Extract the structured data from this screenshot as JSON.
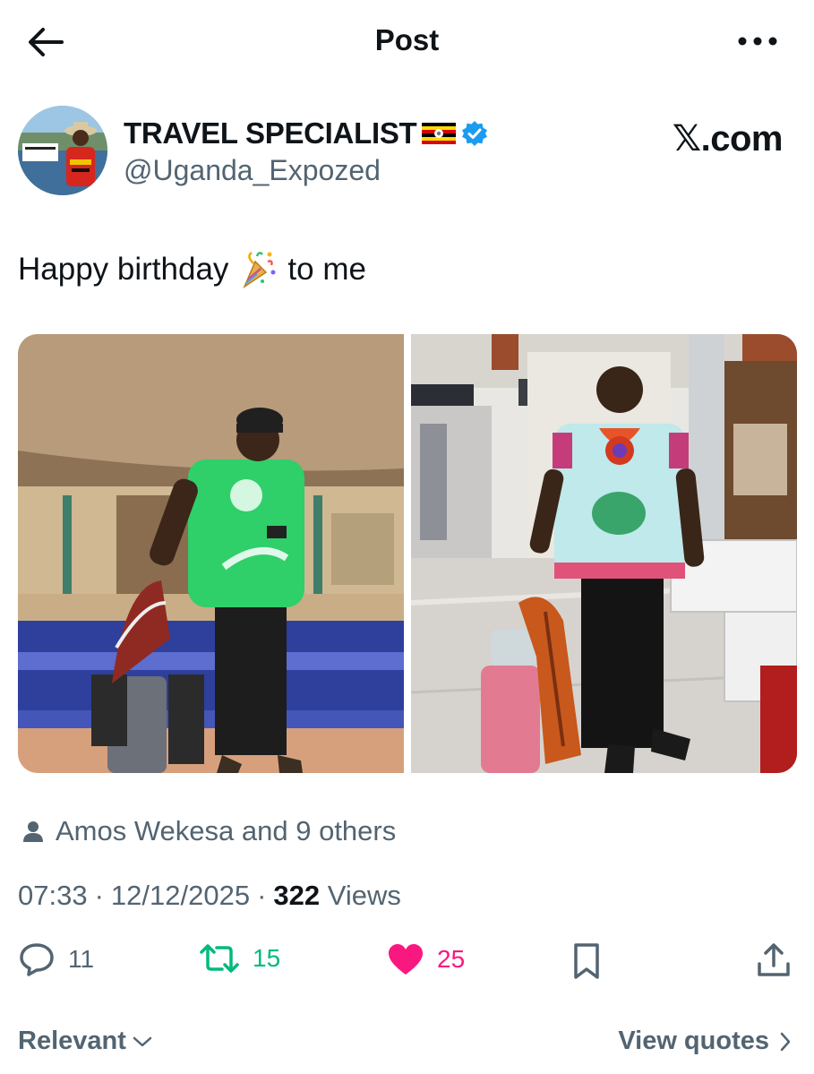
{
  "header": {
    "title": "Post",
    "back_icon": "arrow-left-icon",
    "more_icon": "more-horizontal-icon"
  },
  "author": {
    "display_name": "TRAVEL SPECIALIST",
    "flag_icon": "uganda-flag-icon",
    "verified_icon": "verified-badge-icon",
    "handle": "@Uganda_Expozed",
    "watermark": "𝕏.com"
  },
  "post": {
    "text_before": "Happy birthday",
    "emoji_icon": "party-popper-icon",
    "text_after": "to me"
  },
  "likes": {
    "icon": "person-icon",
    "text": "Amos Wekesa and 9 others"
  },
  "meta": {
    "time": "07:33",
    "separator": "·",
    "date": "12/12/2025",
    "views_count": "322",
    "views_label": "Views"
  },
  "actions": {
    "reply_count": "11",
    "repost_count": "15",
    "like_count": "25"
  },
  "footer": {
    "sort_label": "Relevant",
    "quotes_label": "View quotes"
  },
  "colors": {
    "text_primary": "#0f1419",
    "text_secondary": "#536471",
    "repost": "#00ba7c",
    "like": "#f91880",
    "verified": "#1d9bf0"
  }
}
